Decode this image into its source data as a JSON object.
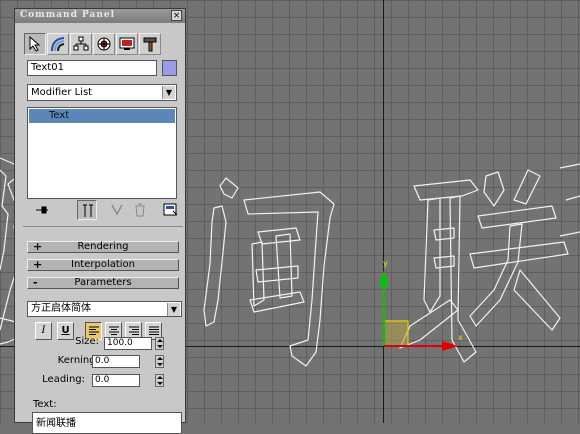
{
  "panel": {
    "title": "Command Panel",
    "close_label": "×",
    "tabs": [
      {
        "name": "create",
        "icon": "cursor-arrow-icon"
      },
      {
        "name": "modify",
        "icon": "rainbow-bend-icon"
      },
      {
        "name": "hierarchy",
        "icon": "hierarchy-icon"
      },
      {
        "name": "motion",
        "icon": "motion-wheel-icon"
      },
      {
        "name": "display",
        "icon": "display-monitor-icon"
      },
      {
        "name": "utilities",
        "icon": "hammer-icon"
      }
    ],
    "selected_tab": "modify",
    "object_name": "Text01",
    "object_color": "#9a9ae8",
    "modifier_list": "Modifier List",
    "stack_item": "Text",
    "rollouts": {
      "rendering": {
        "sign": "+",
        "label": "Rendering"
      },
      "interpolation": {
        "sign": "+",
        "label": "Interpolation"
      },
      "parameters": {
        "sign": "-",
        "label": "Parameters"
      }
    },
    "parameters": {
      "font": "方正启体简体",
      "italic_label": "I",
      "underline_label": "U",
      "size_label": "Size:",
      "size_value": "100.0",
      "kerning_label": "Kerning:",
      "kerning_value": "0.0",
      "leading_label": "Leading:",
      "leading_value": "0.0",
      "text_label": "Text:",
      "text_value": "新闻联播"
    }
  },
  "viewport": {
    "axis_labels": {
      "y": "y",
      "x": "x"
    }
  }
}
